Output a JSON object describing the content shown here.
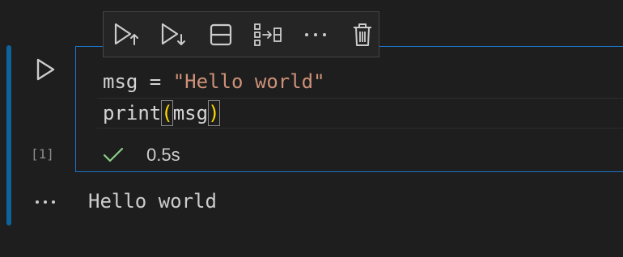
{
  "cell": {
    "execution_count": "[1]",
    "code_lines": [
      {
        "var": "msg",
        "op": " = ",
        "str": "\"Hello world\""
      },
      {
        "func": "print",
        "open": "(",
        "arg": "msg",
        "close": ")"
      }
    ],
    "status": {
      "icon": "checkmark-icon",
      "time": "0.5s"
    },
    "output": {
      "more": "···",
      "text": "Hello world"
    }
  },
  "toolbar": {
    "buttons": [
      {
        "icon": "run-above-icon"
      },
      {
        "icon": "run-below-icon"
      },
      {
        "icon": "split-cell-icon"
      },
      {
        "icon": "join-cells-icon"
      },
      {
        "icon": "more-actions-icon",
        "label": "···"
      },
      {
        "icon": "delete-icon"
      }
    ]
  },
  "colors": {
    "background": "#1e1e1e",
    "accent": "#1a75c7",
    "string": "#ce9178",
    "bracket": "#ffd700",
    "success": "#89d185"
  }
}
